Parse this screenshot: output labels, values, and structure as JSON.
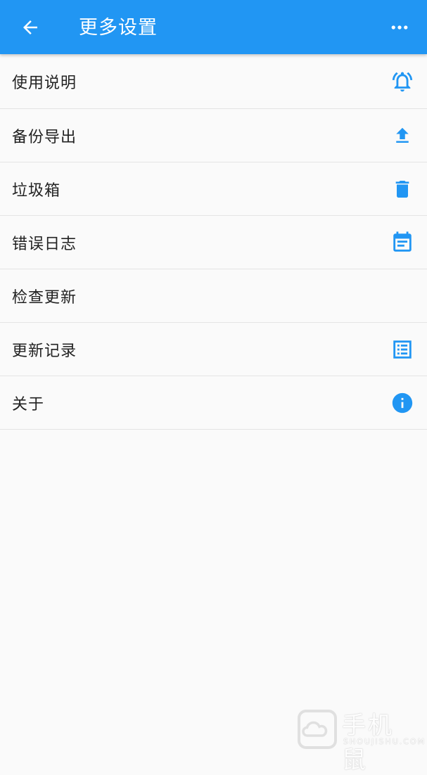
{
  "appbar": {
    "title": "更多设置",
    "back_icon": "arrow-left-icon",
    "more_icon": "more-horiz-icon",
    "color": "#2196f3"
  },
  "items": [
    {
      "label": "使用说明",
      "icon": "alarm-bell-icon"
    },
    {
      "label": "备份导出",
      "icon": "upload-icon"
    },
    {
      "label": "垃圾箱",
      "icon": "trash-icon"
    },
    {
      "label": "错误日志",
      "icon": "calendar-icon"
    },
    {
      "label": "检查更新",
      "icon": ""
    },
    {
      "label": "更新记录",
      "icon": "list-icon"
    },
    {
      "label": "关于",
      "icon": "info-icon"
    }
  ],
  "accent_color": "#2196f3",
  "watermark": {
    "text": "手机鼠",
    "sub": "SHOUJISHU.COM"
  }
}
